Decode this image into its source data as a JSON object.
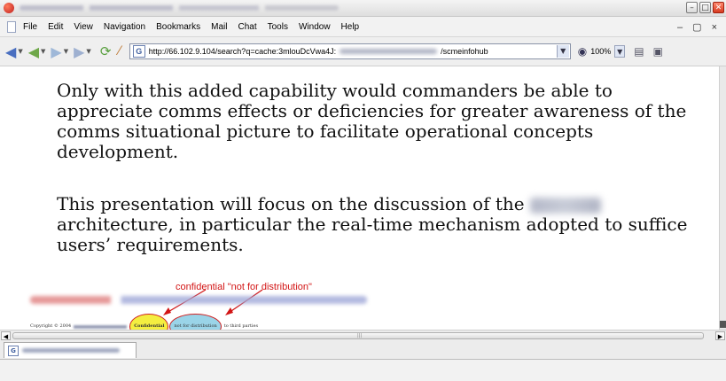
{
  "window": {
    "minimize_glyph": "–",
    "maximize_glyph": "□",
    "close_glyph": "✕"
  },
  "menu": {
    "items": [
      "File",
      "Edit",
      "View",
      "Navigation",
      "Bookmarks",
      "Mail",
      "Chat",
      "Tools",
      "Window",
      "Help"
    ],
    "right_controls": "– ▢ ×"
  },
  "navigation": {
    "url_start": "http://66.102.9.104/search?q=cache:3mlouDcVwa4J:",
    "url_end": "/scmeinfohub",
    "zoom": "100%",
    "icons": [
      "back-icon",
      "forward-icon",
      "reload-icon",
      "stop-icon",
      "search-engine-icon",
      "eye-icon",
      "print-icon"
    ]
  },
  "slide": {
    "paragraph1": "Only with this added capability would commanders be able to appreciate comms effects or deficiencies for greater awareness of the comms situational picture to facilitate operational concepts development.",
    "paragraph2_before": "This presentation will focus on the discussion of the ",
    "paragraph2_after": " architecture, in particular the real-time mechanism adopted to suffice users’ requirements.",
    "annotation": "confidential \"not for distribution\"",
    "copyright_prefix": "Copyright © 2004",
    "highlight_confidential": "Confidential",
    "highlight_not_for_distribution": "not for distribution",
    "copyright_suffix": "to third parties"
  },
  "colors": {
    "annotation_red": "#d21414",
    "highlight_yellow": "#f4ee40",
    "highlight_blue": "#9ad4e8"
  }
}
